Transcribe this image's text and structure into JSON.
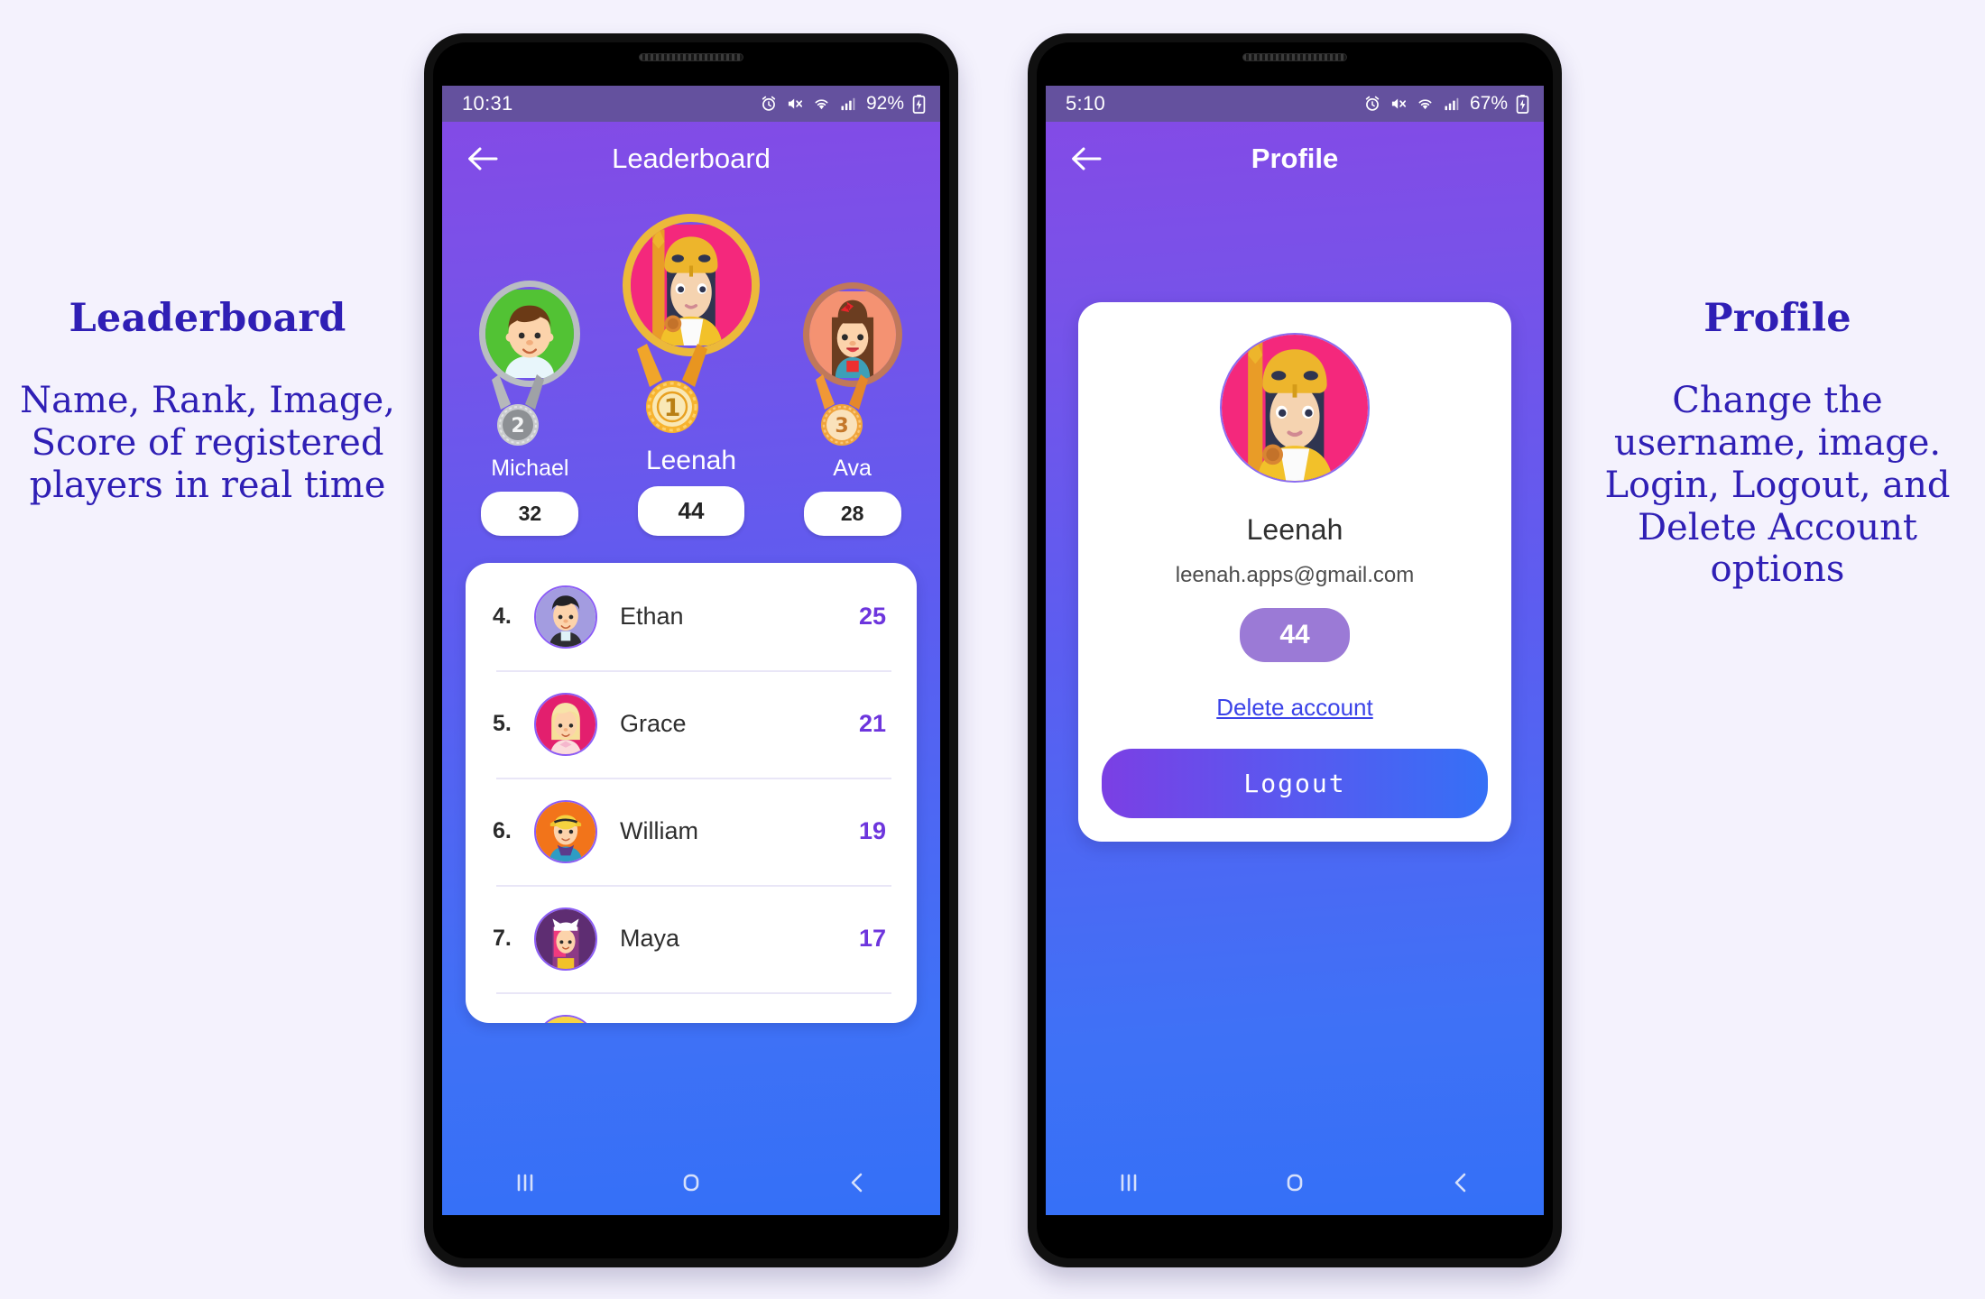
{
  "page": {
    "background": "#f4f2fd",
    "caption_color": "#2f1fb5"
  },
  "captions": {
    "left": {
      "title": "Leaderboard",
      "body": "Name, Rank, Image, Score of registered players in real time"
    },
    "right": {
      "title": "Profile",
      "body": "Change the username, image.\nLogin, Logout, and Delete Account options"
    }
  },
  "phones": [
    {
      "status_bar": {
        "time": "10:31",
        "battery_percent": "92%",
        "icons": [
          "alarm-icon",
          "mute-icon",
          "wifi-icon",
          "signal-icon",
          "battery-charging-icon"
        ]
      },
      "app_bar": {
        "title": "Leaderboard",
        "back_label": "Back",
        "bold": false
      },
      "podium": [
        {
          "rank": 2,
          "name": "Michael",
          "score": "32",
          "medal": "silver",
          "medal_number": "2",
          "ring_color": "#b9bdc2",
          "bg_color": "#52c234"
        },
        {
          "rank": 1,
          "name": "Leenah",
          "score": "44",
          "medal": "gold",
          "medal_number": "1",
          "ring_color": "#ecb93a",
          "bg_color": "#f4287c"
        },
        {
          "rank": 3,
          "name": "Ava",
          "score": "28",
          "medal": "bronze",
          "medal_number": "3",
          "ring_color": "#c0785a",
          "bg_color": "#f49272"
        }
      ],
      "list": [
        {
          "rank": "4.",
          "name": "Ethan",
          "score": "25"
        },
        {
          "rank": "5.",
          "name": "Grace",
          "score": "21"
        },
        {
          "rank": "6.",
          "name": "William",
          "score": "19"
        },
        {
          "rank": "7.",
          "name": "Maya",
          "score": "17"
        }
      ],
      "score_color": "#6d35dd",
      "nav": [
        "recents-icon",
        "home-icon",
        "back-icon"
      ]
    },
    {
      "status_bar": {
        "time": "5:10",
        "battery_percent": "67%",
        "icons": [
          "alarm-icon",
          "mute-icon",
          "wifi-icon",
          "signal-icon",
          "battery-charging-icon"
        ]
      },
      "app_bar": {
        "title": "Profile",
        "back_label": "Back",
        "bold": true
      },
      "profile": {
        "name": "Leenah",
        "email": "leenah.apps@gmail.com",
        "score": "44",
        "score_badge_color": "#9b7ad6",
        "delete_label": "Delete account",
        "delete_color": "#3b43e8",
        "logout_label": "Logout"
      },
      "nav": [
        "recents-icon",
        "home-icon",
        "back-icon"
      ]
    }
  ]
}
